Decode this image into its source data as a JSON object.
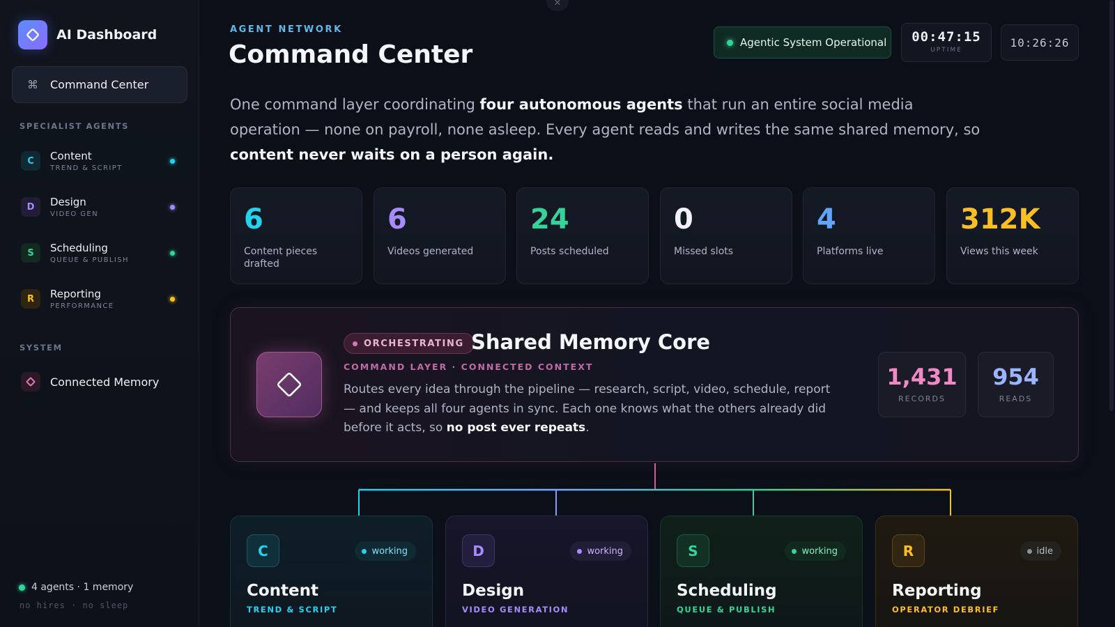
{
  "sidebar": {
    "brand": "AI Dashboard",
    "nav_active": {
      "label": "Command Center",
      "icon": "command-icon"
    },
    "section_agents": "SPECIALIST AGENTS",
    "agents": [
      {
        "badge": "C",
        "name": "Content",
        "sub": "TREND & SCRIPT",
        "color": "#22d3ee"
      },
      {
        "badge": "D",
        "name": "Design",
        "sub": "VIDEO GEN",
        "color": "#a78bfa"
      },
      {
        "badge": "S",
        "name": "Scheduling",
        "sub": "QUEUE & PUBLISH",
        "color": "#34d399"
      },
      {
        "badge": "R",
        "name": "Reporting",
        "sub": "PERFORMANCE",
        "color": "#fbbf24"
      }
    ],
    "section_system": "SYSTEM",
    "memory_label": "Connected Memory",
    "footer_status": "4 agents · 1 memory",
    "footer_sub": "no hires · no sleep"
  },
  "header": {
    "close_glyph": "✕",
    "kicker": "AGENT NETWORK",
    "title": "Command Center",
    "status": "Agentic System Operational",
    "uptime_value": "00:47:15",
    "uptime_label": "UPTIME",
    "clock": "10:26:26"
  },
  "intro": {
    "p1": "One command layer coordinating ",
    "b1": "four autonomous agents",
    "p2": " that run an entire social media operation — none on payroll, none asleep. Every agent reads and writes the same shared memory, so ",
    "b2": "content never waits on a person again."
  },
  "stats": [
    {
      "value": "6",
      "label": "Content pieces drafted",
      "color": "#22d3ee"
    },
    {
      "value": "6",
      "label": "Videos generated",
      "color": "#a78bfa"
    },
    {
      "value": "24",
      "label": "Posts scheduled",
      "color": "#34d399"
    },
    {
      "value": "0",
      "label": "Missed slots",
      "color": "#f1f3f8"
    },
    {
      "value": "4",
      "label": "Platforms live",
      "color": "#60a5fa"
    },
    {
      "value": "312K",
      "label": "Views this week",
      "color": "#fbbf24"
    }
  ],
  "core": {
    "pill": "ORCHESTRATING",
    "title": "Shared Memory Core",
    "sub": "COMMAND LAYER · CONNECTED CONTEXT",
    "desc_p1": "Routes every idea through the pipeline — research, script, video, schedule, report — and keeps all four agents in sync. Each one knows what the others already did before it acts, so ",
    "desc_b": "no post ever repeats",
    "desc_p2": ".",
    "records_value": "1,431",
    "records_label": "RECORDS",
    "reads_value": "954",
    "reads_label": "READS"
  },
  "agent_cards": [
    {
      "badge": "C",
      "status": "working",
      "name": "Content",
      "sub": "TREND & SCRIPT",
      "color": "#22d3ee"
    },
    {
      "badge": "D",
      "status": "working",
      "name": "Design",
      "sub": "VIDEO GENERATION",
      "color": "#a78bfa"
    },
    {
      "badge": "S",
      "status": "working",
      "name": "Scheduling",
      "sub": "QUEUE & PUBLISH",
      "color": "#34d399"
    },
    {
      "badge": "R",
      "status": "idle",
      "name": "Reporting",
      "sub": "OPERATOR DEBRIEF",
      "color": "#fbbf24"
    }
  ]
}
